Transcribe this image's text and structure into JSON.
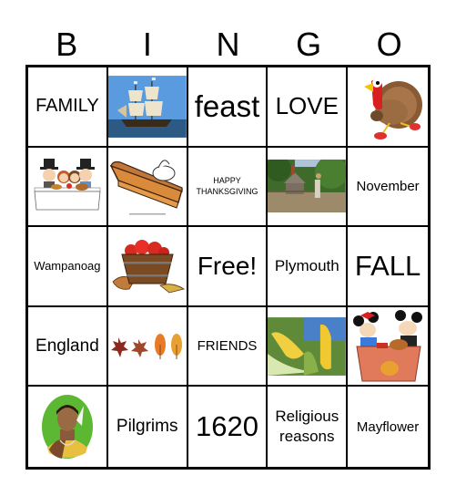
{
  "title_letters": [
    "B",
    "I",
    "N",
    "G",
    "O"
  ],
  "cells": [
    {
      "type": "text",
      "text": "FAMILY"
    },
    {
      "type": "image",
      "icon": "mayflower-ship-image"
    },
    {
      "type": "text",
      "text": "feast"
    },
    {
      "type": "text",
      "text": "LOVE"
    },
    {
      "type": "image",
      "icon": "running-turkey-image"
    },
    {
      "type": "image",
      "icon": "pilgrim-family-dinner-image"
    },
    {
      "type": "image",
      "icon": "pumpkin-pie-image"
    },
    {
      "type": "text",
      "text": "HAPPY THANKSGIVING"
    },
    {
      "type": "image",
      "icon": "pilgrim-farm-house-image"
    },
    {
      "type": "text",
      "text": "November"
    },
    {
      "type": "text",
      "text": "Wampanoag"
    },
    {
      "type": "image",
      "icon": "apple-basket-image"
    },
    {
      "type": "text",
      "text": "Free!"
    },
    {
      "type": "text",
      "text": "Plymouth"
    },
    {
      "type": "text",
      "text": "FALL"
    },
    {
      "type": "text",
      "text": "England"
    },
    {
      "type": "image",
      "icon": "autumn-leaves-image"
    },
    {
      "type": "text",
      "text": "FRIENDS"
    },
    {
      "type": "image",
      "icon": "corn-image"
    },
    {
      "type": "image",
      "icon": "mickey-minnie-thanksgiving-image"
    },
    {
      "type": "image",
      "icon": "native-american-portrait-image"
    },
    {
      "type": "text",
      "text": "Pilgrims"
    },
    {
      "type": "text",
      "text": "1620"
    },
    {
      "type": "text",
      "text": "Religious reasons"
    },
    {
      "type": "text",
      "text": "Mayflower"
    }
  ],
  "colors": {
    "grid_line": "#000000",
    "background": "#ffffff"
  }
}
